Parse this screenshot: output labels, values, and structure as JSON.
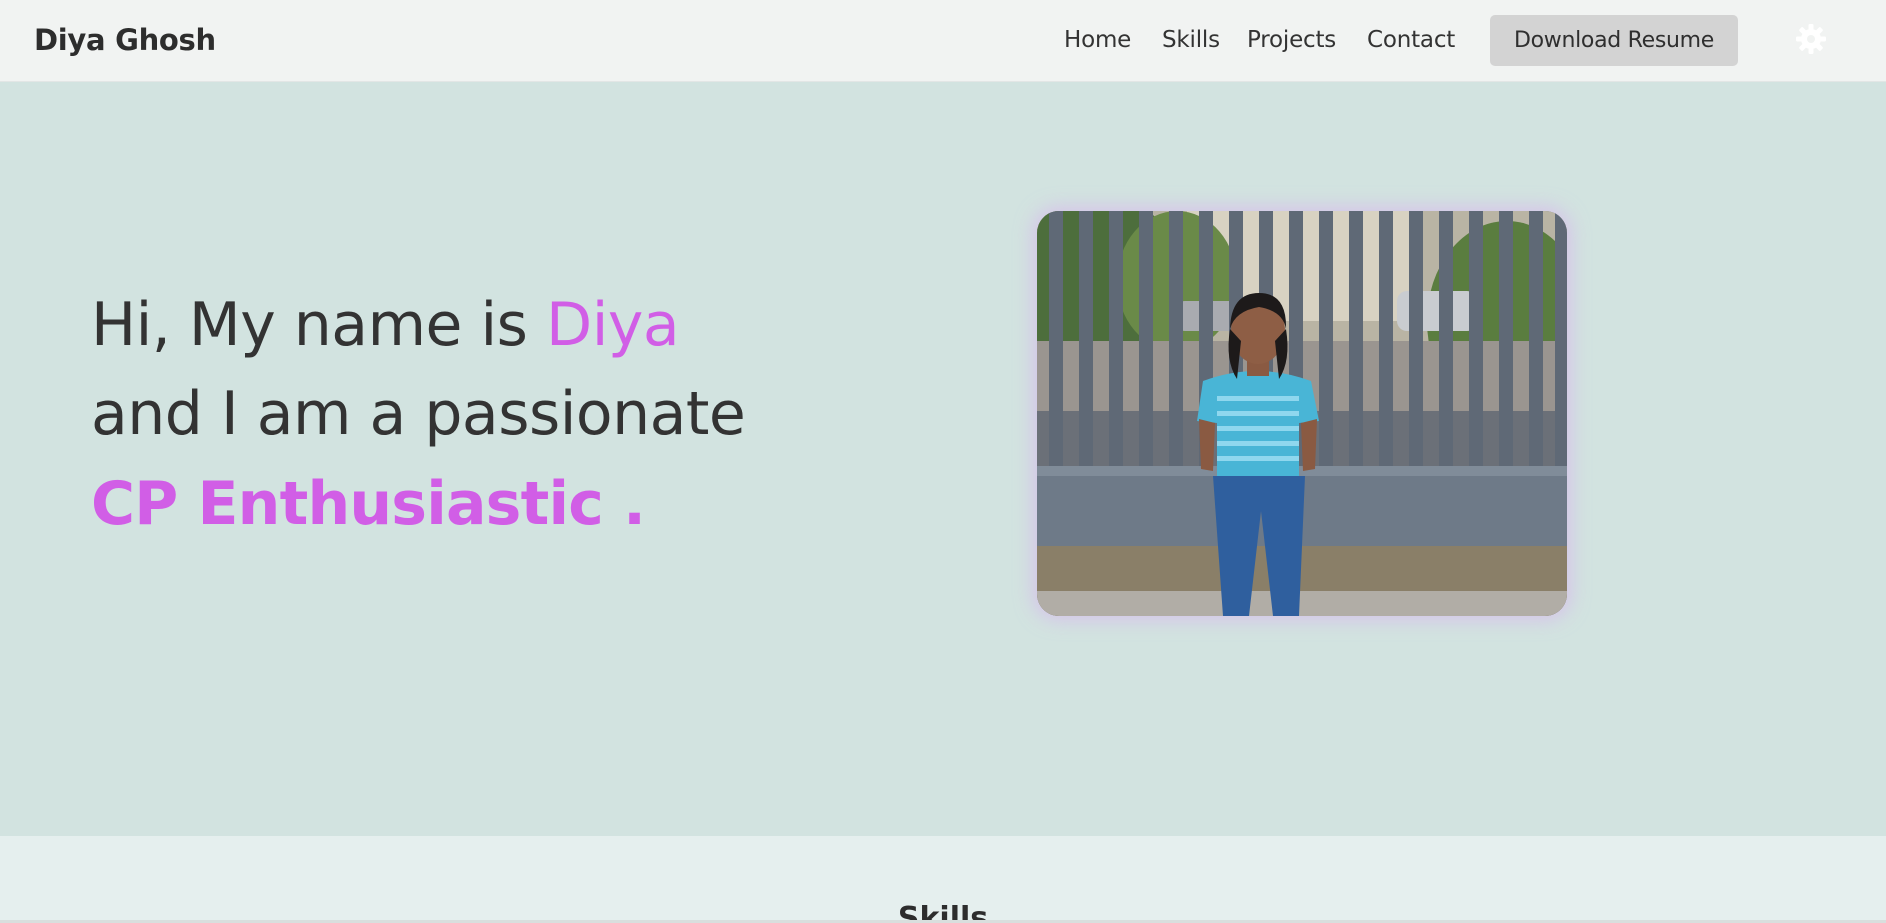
{
  "navbar": {
    "brand": "Diya Ghosh",
    "links": [
      {
        "label": "Home"
      },
      {
        "label": "Skills"
      },
      {
        "label": "Projects"
      },
      {
        "label": "Contact"
      }
    ],
    "resume_button_label": "Download Resume",
    "theme_toggle_icon": "gear-icon"
  },
  "hero": {
    "line1_prefix": "Hi, My name is ",
    "line1_name": "Diya",
    "line2": "and I am a passionate",
    "line3": "CP Enthusiastic .",
    "photo_alt": "Diya Ghosh"
  },
  "skills": {
    "heading": "Skills"
  },
  "colors": {
    "accent": "#d15ee6",
    "navbar_bg": "#f1f3f2",
    "hero_bg": "#d2e3e0",
    "section_bg": "#e5efee",
    "button_bg": "#d3d3d3",
    "text": "#333333"
  }
}
